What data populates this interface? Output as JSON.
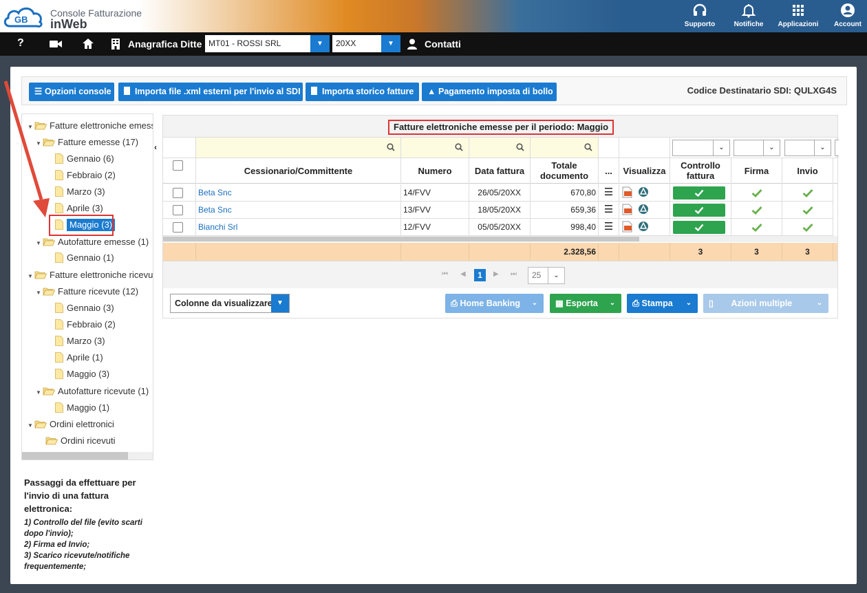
{
  "app": {
    "line1": "Console Fatturazione",
    "line2": "inWeb",
    "logo_text": "GB"
  },
  "topnav": [
    {
      "label": "Supporto",
      "icon": "headset-icon"
    },
    {
      "label": "Notifiche",
      "icon": "bell-icon"
    },
    {
      "label": "Applicazioni",
      "icon": "apps-grid-icon"
    },
    {
      "label": "Account",
      "icon": "account-icon"
    }
  ],
  "navbar": {
    "help": "?",
    "anagrafica": "Anagrafica Ditte",
    "ditta": "MT01 - ROSSI SRL",
    "anno": "20XX",
    "contatti": "Contatti"
  },
  "toolbar": {
    "opzioni": "Opzioni console",
    "importa_xml": "Importa file .xml esterni per l'invio al SDI",
    "importa_storico": "Importa storico fatture",
    "pagamento": "Pagamento imposta di bollo",
    "codice": "Codice Destinatario SDI: QULXG4S"
  },
  "tree": {
    "n0": "Fatture elettroniche emesse",
    "n1": "Fatture emesse (17)",
    "n2": "Gennaio (6)",
    "n3": "Febbraio (2)",
    "n4": "Marzo (3)",
    "n5": "Aprile (3)",
    "n6": "Maggio (3)",
    "n7": "Autofatture emesse (1)",
    "n8": "Gennaio (1)",
    "n9": "Fatture elettroniche ricevute",
    "n10": "Fatture ricevute (12)",
    "n11": "Gennaio (3)",
    "n12": "Febbraio (2)",
    "n13": "Marzo (3)",
    "n14": "Aprile (1)",
    "n15": "Maggio (3)",
    "n16": "Autofatture ricevute (1)",
    "n17": "Maggio (1)",
    "n18": "Ordini elettronici",
    "n19": "Ordini ricevuti"
  },
  "steps": {
    "title": "Passaggi da effettuare per l'invio di una fattura elettronica:",
    "s1": "1) Controllo del file (evito scarti dopo l'invio);",
    "s2": "2) Firma ed Invio;",
    "s3": "3) Scarico ricevute/notifiche frequentemente;"
  },
  "grid": {
    "title": "Fatture elettroniche emesse per il periodo: Maggio",
    "headers": {
      "cess": "Cessionario/Committente",
      "numero": "Numero",
      "data": "Data fattura",
      "totale": "Totale documento",
      "more": "...",
      "visualizza": "Visualizza",
      "controllo": "Controllo fattura",
      "firma": "Firma",
      "invio": "Invio"
    },
    "rows": [
      {
        "cess": "Beta Snc",
        "numero": "14/FVV",
        "data": "26/05/20XX",
        "totale": "670,80"
      },
      {
        "cess": "Beta Snc",
        "numero": "13/FVV",
        "data": "18/05/20XX",
        "totale": "659,36"
      },
      {
        "cess": "Bianchi Srl",
        "numero": "12/FVV",
        "data": "05/05/20XX",
        "totale": "998,40"
      }
    ],
    "totals": {
      "totale": "2.328,56",
      "controllo": "3",
      "firma": "3",
      "invio": "3"
    },
    "pager": {
      "page": "1",
      "size": "25"
    }
  },
  "actions": {
    "colonne": "Colonne da visualizzare",
    "home": "Home Banking",
    "esporta": "Esporta",
    "stampa": "Stampa",
    "azioni": "Azioni multiple"
  },
  "colors": {
    "accent": "#1a7bd0",
    "ok": "#2ea44f",
    "check": "#6ab04c",
    "red": "#d33"
  }
}
